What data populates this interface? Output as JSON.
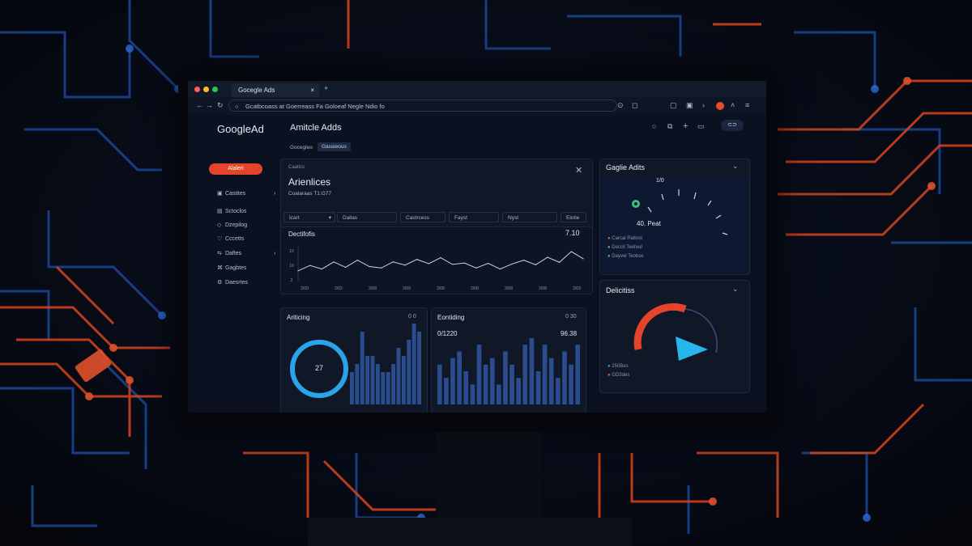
{
  "browser": {
    "tab_title": "Gocegle Ads",
    "url": "Gcatbcoass at Goerreass Fa Goloeaf Negle Ndio fo"
  },
  "app": {
    "logo": "GoogleAd",
    "header_title": "Amitcle Adds",
    "breadcrumb": [
      "Gocegleo",
      "Gassieous"
    ],
    "header_pill": "⊂⊃"
  },
  "sidebar": {
    "primary_button": "Alaleri",
    "items": [
      {
        "label": "Castites",
        "icon": "grid-icon"
      },
      {
        "label": "Sctoclos",
        "icon": "chart-icon"
      },
      {
        "label": "Dzepilog",
        "icon": "tag-icon"
      },
      {
        "label": "Cccetts",
        "icon": "heart-icon"
      },
      {
        "label": "Daftes",
        "icon": "link-icon"
      },
      {
        "label": "Gagbtes",
        "icon": "code-icon"
      },
      {
        "label": "Daesrtes",
        "icon": "gear-icon"
      }
    ]
  },
  "main_panel": {
    "kicker": "Caatics",
    "title": "Arienlices",
    "subtitle": "Coalaraas T1:G77",
    "filters": [
      "Icart",
      "Dallas",
      "Castrcess",
      "Fayst",
      "Nyst",
      "Elotie"
    ],
    "line_chart": {
      "title": "Dectifofis",
      "value": "7.10"
    }
  },
  "bottom_left": {
    "title": "Ariticing",
    "right": "0 0",
    "ring_value": "27"
  },
  "bottom_right": {
    "title": "Eontiding",
    "left_value": "0/1220",
    "right_value": "96.38",
    "corner": "0 30"
  },
  "right_top": {
    "title": "Gaglie Adits",
    "gauge_value": "40. Peat",
    "gauge_tick": "1/0",
    "legend": [
      {
        "label": "Carcal Pattost",
        "color": "#e4542c"
      },
      {
        "label": "Deccil Teehed",
        "color": "#39c07a"
      },
      {
        "label": "Dayvel Teobse",
        "color": "#39c07a"
      }
    ]
  },
  "right_bottom": {
    "title": "Delicitiss",
    "legend": [
      {
        "label": "250Bes",
        "color": "#2aa4e8"
      },
      {
        "label": "GD3des",
        "color": "#e4542c"
      }
    ]
  },
  "chart_data": [
    {
      "type": "line",
      "x": [
        1,
        2,
        3,
        4,
        5,
        6,
        7,
        8,
        9,
        10,
        11,
        12,
        13,
        14,
        15,
        16,
        17,
        18,
        19,
        20,
        21,
        22,
        23,
        24,
        25
      ],
      "y": [
        3,
        4.5,
        3.5,
        5.5,
        4,
        6,
        4.2,
        3.8,
        5.5,
        4.6,
        6.2,
        5,
        6.7,
        4.8,
        5.2,
        3.8,
        5.1,
        3.5,
        4.9,
        6.0,
        4.7,
        6.8,
        5.4,
        8.4,
        6.4
      ],
      "xticks": [
        "2/09",
        "2/02",
        "2/08",
        "2/09",
        "2/08",
        "2/08",
        "2/08",
        "2/08",
        "2/03"
      ],
      "yticks": [
        "10",
        "10",
        "2"
      ],
      "ylim": [
        0,
        10
      ]
    },
    {
      "type": "bar",
      "values": [
        4,
        5,
        9,
        6,
        6,
        5,
        4,
        4,
        5,
        7,
        6,
        8,
        10,
        9
      ],
      "ylim": [
        0,
        10
      ]
    },
    {
      "type": "bar",
      "values": [
        6,
        4,
        7,
        8,
        5,
        3,
        9,
        6,
        7,
        3,
        8,
        6,
        4,
        9,
        10,
        5,
        9,
        7,
        4,
        8,
        6,
        9
      ],
      "ylim": [
        0,
        10
      ]
    }
  ],
  "colors": {
    "accent_red": "#e4542c",
    "accent_blue": "#2aa4e8",
    "bar_blue": "#2b4d8e"
  }
}
